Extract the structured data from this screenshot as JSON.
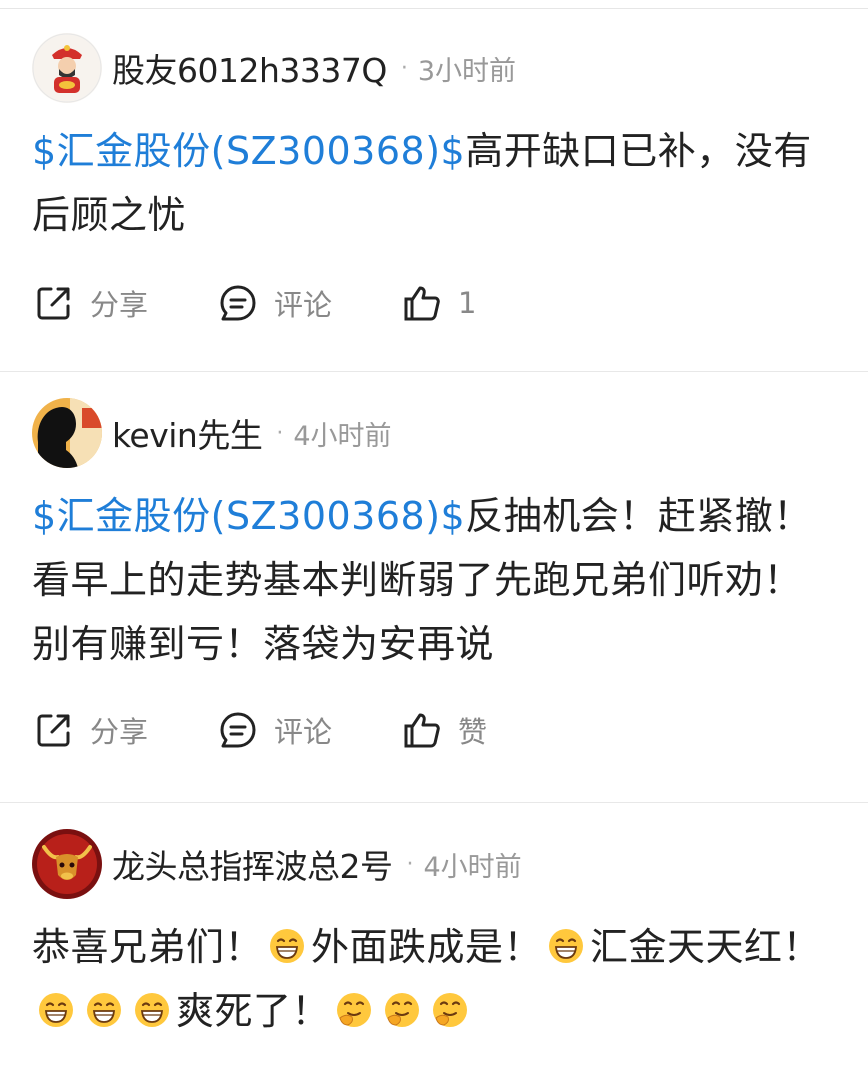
{
  "posts": [
    {
      "username": "股友6012h3337Q",
      "time": "3小时前",
      "stock_link": "$汇金股份(SZ300368)$",
      "body": "高开缺口已补，没有后顾之忧",
      "actions": {
        "share": "分享",
        "comment": "评论",
        "like": "1"
      },
      "avatar": "god-of-wealth-avatar"
    },
    {
      "username": "kevin先生",
      "time": "4小时前",
      "stock_link": "$汇金股份(SZ300368)$",
      "body": "反抽机会！赶紧撤！看早上的走势基本判断弱了先跑兄弟们听劝！别有赚到亏！落袋为安再说",
      "actions": {
        "share": "分享",
        "comment": "评论",
        "like": "赞"
      },
      "avatar": "silhouette-avatar"
    },
    {
      "username": "龙头总指挥波总2号",
      "time": "4小时前",
      "body_parts": [
        "恭喜兄弟们！",
        "外面跌成是！",
        "汇金天天红！",
        "爽死了！"
      ],
      "avatar": "bull-avatar",
      "emoji_names": [
        "grinning-emoji",
        "thinking-emoji"
      ]
    }
  ],
  "separator": "·",
  "colors": {
    "link": "#1f7ed8",
    "text": "#222222",
    "muted": "#999999"
  }
}
